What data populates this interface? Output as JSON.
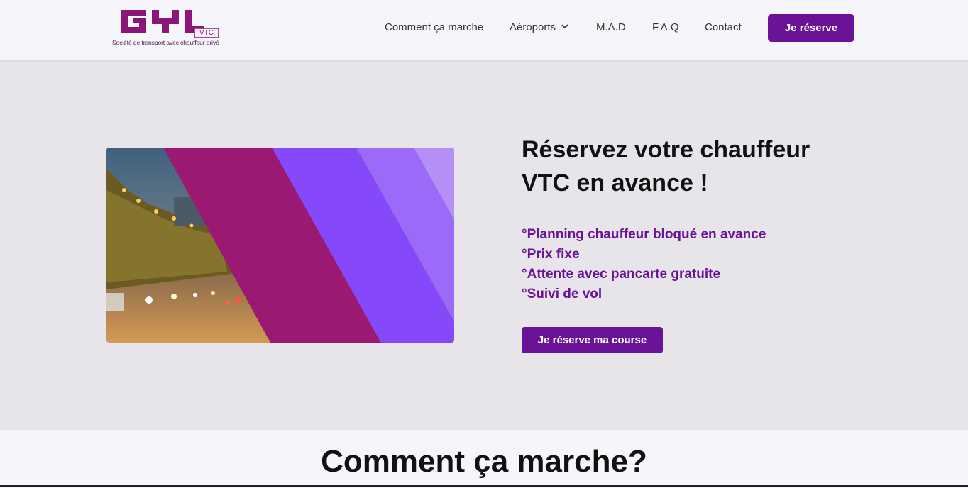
{
  "header": {
    "logo": {
      "wordmark": "GYL",
      "badge": "VTC",
      "tagline": "Société de transport avec chauffeur privé"
    },
    "nav": [
      {
        "label": "Comment ça marche"
      },
      {
        "label": "Aéroports",
        "icon": "chevron-down-icon"
      },
      {
        "label": "M.A.D"
      },
      {
        "label": "F.A.Q"
      },
      {
        "label": "Contact"
      }
    ],
    "cta_label": "Je réserve"
  },
  "hero": {
    "title_line1": "Réservez votre chauffeur",
    "title_line2": "VTC en avance !",
    "features": [
      "°Planning chauffeur bloqué en avance",
      "°Prix fixe",
      "°Attente avec pancarte gratuite",
      "°Suivi de vol"
    ],
    "cta_label": "Je réserve ma course"
  },
  "section2": {
    "title": "Comment ça marche?"
  },
  "colors": {
    "brand_purple": "#6b1396",
    "magenta": "#9b1873",
    "violet": "#8549fa",
    "background": "#e7e5ea"
  }
}
